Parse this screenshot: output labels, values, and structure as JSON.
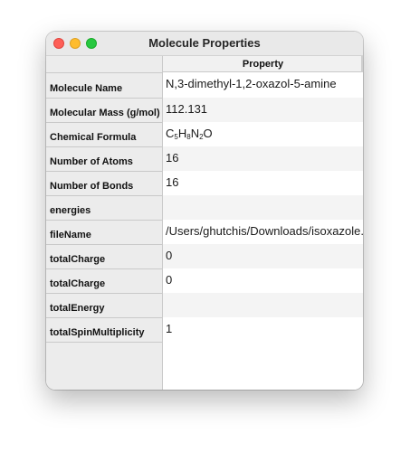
{
  "window": {
    "title": "Molecule Properties"
  },
  "table": {
    "column_header": "Property",
    "rows": [
      {
        "label": "Molecule Name",
        "value": "N,3-dimethyl-1,2-oxazol-5-amine"
      },
      {
        "label": "Molecular Mass (g/mol)",
        "value": "112.131"
      },
      {
        "label": "Chemical Formula",
        "value": "C5H8N2O"
      },
      {
        "label": "Number of Atoms",
        "value": "16"
      },
      {
        "label": "Number of Bonds",
        "value": "16"
      },
      {
        "label": "energies",
        "value": ""
      },
      {
        "label": "fileName",
        "value": "/Users/ghutchis/Downloads/isoxazole.g"
      },
      {
        "label": "totalCharge",
        "value": "0"
      },
      {
        "label": "totalCharge",
        "value": "0"
      },
      {
        "label": "totalEnergy",
        "value": ""
      },
      {
        "label": "totalSpinMultiplicity",
        "value": "1"
      }
    ]
  }
}
